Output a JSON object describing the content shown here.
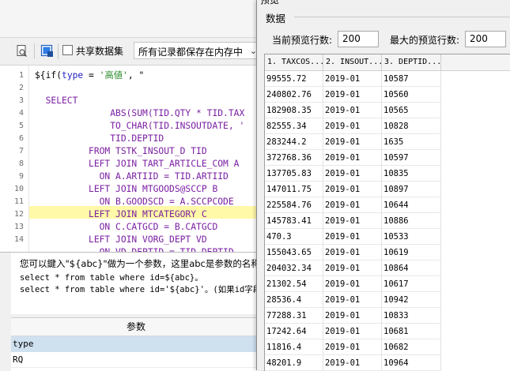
{
  "toolbar": {
    "share_label": "共享数据集",
    "storage_select": "所有记录都保存在内存中"
  },
  "editor": {
    "line_numbers": [
      "1",
      "2",
      "3",
      "4",
      "5",
      "6",
      "7",
      "8",
      "9",
      "10",
      "11",
      "12",
      "13",
      "14"
    ],
    "first_line": {
      "prefix": "${if(",
      "keyword": "type",
      "middle": " = ",
      "string": "'高値'",
      "suffix": ", \""
    },
    "lines": [
      "",
      "  SELECT",
      "              ABS(SUM(TID.QTY * TID.TAX",
      "              TO_CHAR(TID.INSOUTDATE, '",
      "              TID.DEPTID",
      "          FROM TSTK_INSOUT_D TID",
      "          LEFT JOIN TART_ARTICLE_COM A",
      "            ON A.ARTIID = TID.ARTIID",
      "          LEFT JOIN MTGOODS@SCCP B",
      "            ON B.GOODSCD = A.SCCPCODE",
      "          LEFT JOIN MTCATEGORY C",
      "            ON C.CATGCD = B.CATGCD",
      "          LEFT JOIN VORG_DEPT VD",
      "            ON VD.DEPTID = TID.DEPTID"
    ]
  },
  "hint": {
    "line1": "您可以鍵入\"${abc}\"做为一个参数，这里abc是参数的名称",
    "line2": "select * from table where id=${abc}。",
    "line3": "select * from table where id='${abc}'。(如果id字段"
  },
  "params": {
    "title": "参数",
    "header": "type",
    "rows": [
      "RQ"
    ]
  },
  "preview": {
    "dialog_title": "预览",
    "group_label": "数据",
    "current_rows_label": "当前预览行数:",
    "current_rows_value": "200",
    "max_rows_label": "最大的预览行数:",
    "max_rows_value": "200",
    "columns": [
      "1. TAXCOS...",
      "2. INSOUT...",
      "3. DEPTID..."
    ],
    "rows": [
      [
        "99555.72",
        "2019-01",
        "10587"
      ],
      [
        "240802.76",
        "2019-01",
        "10560"
      ],
      [
        "182908.35",
        "2019-01",
        "10565"
      ],
      [
        "82555.34",
        "2019-01",
        "10828"
      ],
      [
        "283244.2",
        "2019-01",
        "1635"
      ],
      [
        "372768.36",
        "2019-01",
        "10597"
      ],
      [
        "137705.83",
        "2019-01",
        "10835"
      ],
      [
        "147011.75",
        "2019-01",
        "10897"
      ],
      [
        "225584.76",
        "2019-01",
        "10644"
      ],
      [
        "145783.41",
        "2019-01",
        "10886"
      ],
      [
        "470.3",
        "2019-01",
        "10533"
      ],
      [
        "155043.65",
        "2019-01",
        "10619"
      ],
      [
        "204032.34",
        "2019-01",
        "10864"
      ],
      [
        "21302.54",
        "2019-01",
        "10617"
      ],
      [
        "28536.4",
        "2019-01",
        "10942"
      ],
      [
        "77288.31",
        "2019-01",
        "10833"
      ],
      [
        "17242.64",
        "2019-01",
        "10681"
      ],
      [
        "11816.4",
        "2019-01",
        "10682"
      ],
      [
        "48201.9",
        "2019-01",
        "10964"
      ]
    ]
  }
}
